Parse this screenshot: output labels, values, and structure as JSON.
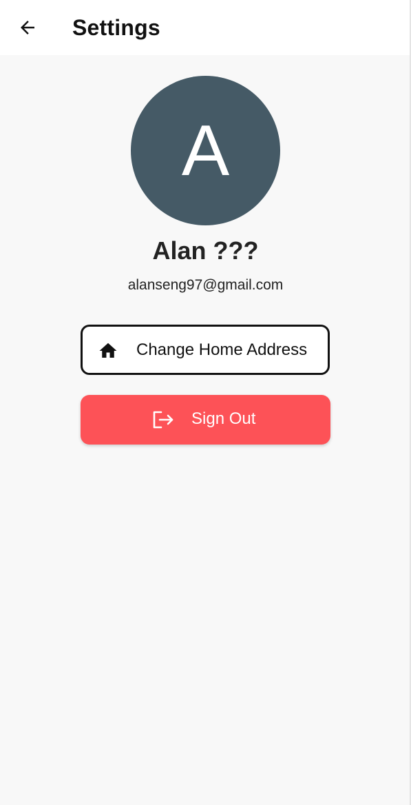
{
  "header": {
    "back_icon": "arrow-left-icon",
    "title": "Settings"
  },
  "profile": {
    "avatar_initial": "A",
    "avatar_color": "#455a66",
    "name": "Alan ???",
    "email": "alanseng97@gmail.com"
  },
  "actions": {
    "change_address": {
      "icon": "home-icon",
      "label": "Change Home Address"
    },
    "sign_out": {
      "icon": "logout-icon",
      "label": "Sign Out",
      "color": "#fd5257"
    }
  }
}
